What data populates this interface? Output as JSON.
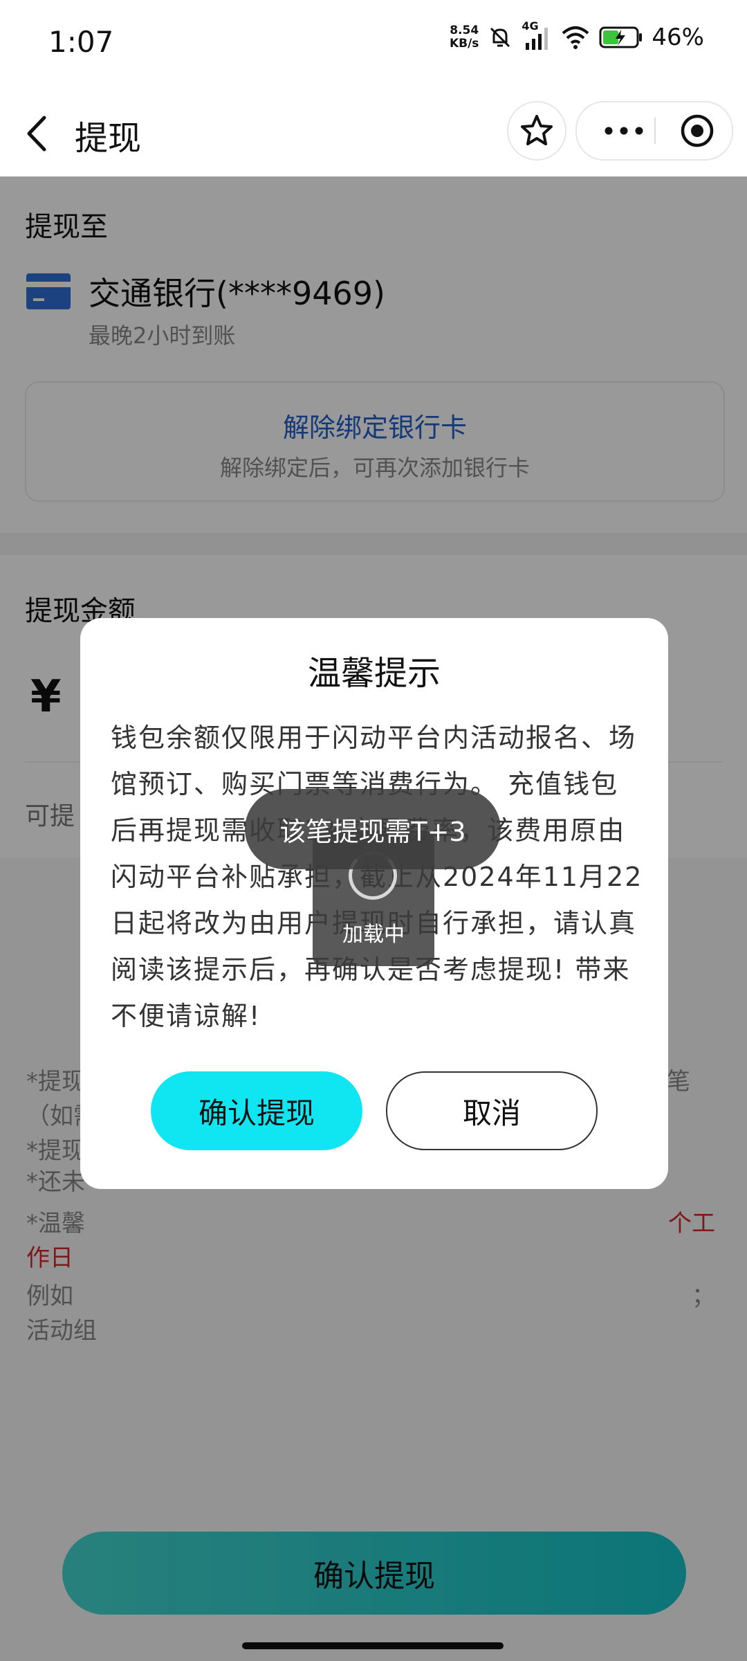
{
  "status_bar": {
    "time": "1:07",
    "net_speed_value": "8.54",
    "net_speed_unit": "KB/s",
    "network_type": "4G",
    "battery_percent": "46%"
  },
  "nav": {
    "title": "提现"
  },
  "withdraw_to": {
    "section_title": "提现至",
    "bank_name": "交通银行(****9469)",
    "arrival_hint": "最晚2小时到账",
    "unbind_title": "解除绑定银行卡",
    "unbind_subtitle": "解除绑定后，可再次添加银行卡"
  },
  "amount": {
    "section_title": "提现金额",
    "currency_symbol": "¥",
    "available_label": "可提"
  },
  "notes": {
    "line1_start": "*提现",
    "line1_end": "笔",
    "line2": "（如需",
    "line3": "*提现",
    "line4": "*还未",
    "line5_start": "*温馨",
    "line5_end": "个工",
    "line6": "作日",
    "line7_start": "例如",
    "line7_end": "；",
    "line8": "活动组"
  },
  "bottom_button": {
    "label": "确认提现"
  },
  "dialog": {
    "title": "温馨提示",
    "body": "钱包余额仅限用于闪动平台内活动报名、场馆预订、购买门票等消费行为。 充值钱包后再提现需收取3%交易费率，该费用原由闪动平台补贴承担，截止从2024年11月22日起将改为由用户提现时自行承担，请认真阅读该提示后，再确认是否考虑提现! 带来不便请谅解!",
    "confirm_label": "确认提现",
    "cancel_label": "取消"
  },
  "loading": {
    "text": "加载中"
  },
  "toast": {
    "text": "该笔提现需T+3"
  },
  "colors": {
    "accent_cyan": "#10e6f2",
    "link_blue": "#2060c8",
    "warning_red": "#d42b2b",
    "bank_icon_blue": "#2f6fd4"
  }
}
